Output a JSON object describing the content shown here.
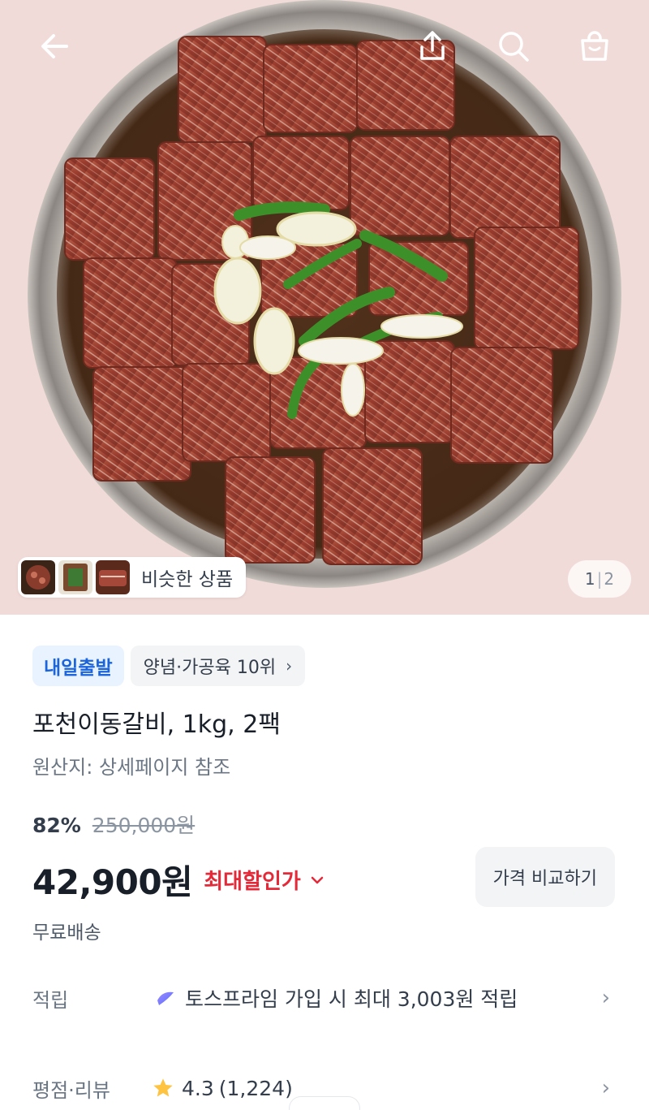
{
  "header": {
    "back_icon": "arrow-left-icon",
    "share_icon": "share-icon",
    "search_icon": "search-icon",
    "cart_icon": "shopping-bag-icon"
  },
  "gallery": {
    "similar_label": "비슷한 상품",
    "current_page": "1",
    "separator": "|",
    "total_pages": "2"
  },
  "product": {
    "badge_delivery": "내일출발",
    "badge_rank": "양념·가공육 10위",
    "badge_rank_chevron": "›",
    "name": "포천이동갈비, 1kg, 2팩",
    "origin": "원산지: 상세페이지 참조",
    "discount_rate": "82%",
    "original_price": "250,000원",
    "price": "42,900원",
    "max_discount_label": "최대할인가",
    "compare_button": "가격 비교하기",
    "shipping": "무료배송"
  },
  "reward": {
    "label": "적립",
    "text": "토스프라임 가입 시 최대 3,003원 적립",
    "chevron": "›"
  },
  "review": {
    "label": "평점·리뷰",
    "rating": "4.3",
    "count": "(1,224)",
    "chevron": "›"
  },
  "colors": {
    "hero_background": "#f1dbd8",
    "accent_blue": "#1b64da",
    "accent_red": "#e42939",
    "text_primary": "#191f28",
    "text_secondary": "#6b7684"
  }
}
